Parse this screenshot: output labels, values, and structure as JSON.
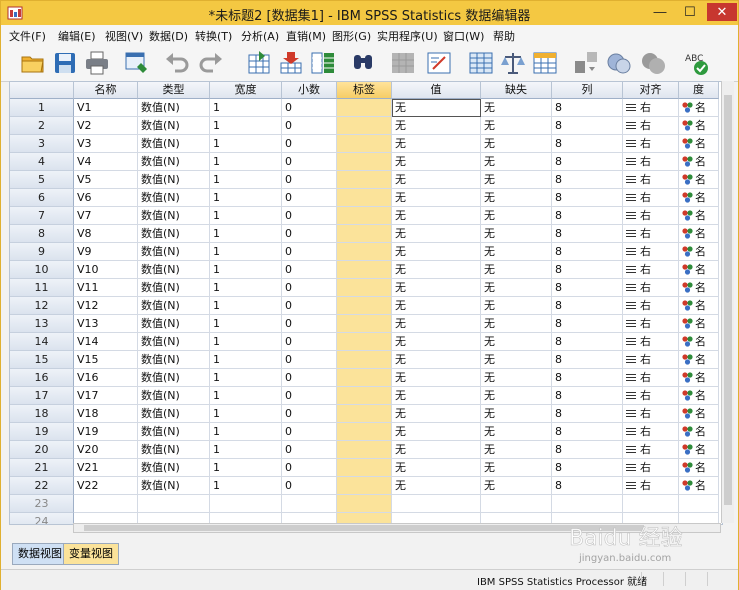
{
  "window": {
    "title": "*未标题2 [数据集1] - IBM SPSS Statistics 数据编辑器",
    "buttons": {
      "minimize": "—",
      "maximize": "☐",
      "close": "✕"
    }
  },
  "menu": [
    "文件(F)",
    "编辑(E)",
    "视图(V)",
    "数据(D)",
    "转换(T)",
    "分析(A)",
    "直销(M)",
    "图形(G)",
    "实用程序(U)",
    "窗口(W)",
    "帮助"
  ],
  "toolbar": [
    "open-icon",
    "save-icon",
    "print-icon",
    "dialog-recall-icon",
    "undo-icon",
    "redo-icon",
    "goto-case-icon",
    "goto-variable-icon",
    "variables-icon",
    "find-icon",
    "insert-cases-icon",
    "insert-variable-icon",
    "split-file-icon",
    "weight-cases-icon",
    "select-cases-icon",
    "value-labels-icon",
    "use-sets-icon",
    "show-all-icon",
    "spell-check-icon"
  ],
  "columns": [
    "名称",
    "类型",
    "宽度",
    "小数",
    "标签",
    "值",
    "缺失",
    "列",
    "对齐",
    "度"
  ],
  "rows": [
    {
      "num": "1",
      "name": "V1",
      "type": "数值(N)",
      "width": "1",
      "decimals": "0",
      "label": "",
      "values": "无",
      "missing": "无",
      "columns": "8",
      "align": "右",
      "measure": "名"
    },
    {
      "num": "2",
      "name": "V2",
      "type": "数值(N)",
      "width": "1",
      "decimals": "0",
      "label": "",
      "values": "无",
      "missing": "无",
      "columns": "8",
      "align": "右",
      "measure": "名"
    },
    {
      "num": "3",
      "name": "V3",
      "type": "数值(N)",
      "width": "1",
      "decimals": "0",
      "label": "",
      "values": "无",
      "missing": "无",
      "columns": "8",
      "align": "右",
      "measure": "名"
    },
    {
      "num": "4",
      "name": "V4",
      "type": "数值(N)",
      "width": "1",
      "decimals": "0",
      "label": "",
      "values": "无",
      "missing": "无",
      "columns": "8",
      "align": "右",
      "measure": "名"
    },
    {
      "num": "5",
      "name": "V5",
      "type": "数值(N)",
      "width": "1",
      "decimals": "0",
      "label": "",
      "values": "无",
      "missing": "无",
      "columns": "8",
      "align": "右",
      "measure": "名"
    },
    {
      "num": "6",
      "name": "V6",
      "type": "数值(N)",
      "width": "1",
      "decimals": "0",
      "label": "",
      "values": "无",
      "missing": "无",
      "columns": "8",
      "align": "右",
      "measure": "名"
    },
    {
      "num": "7",
      "name": "V7",
      "type": "数值(N)",
      "width": "1",
      "decimals": "0",
      "label": "",
      "values": "无",
      "missing": "无",
      "columns": "8",
      "align": "右",
      "measure": "名"
    },
    {
      "num": "8",
      "name": "V8",
      "type": "数值(N)",
      "width": "1",
      "decimals": "0",
      "label": "",
      "values": "无",
      "missing": "无",
      "columns": "8",
      "align": "右",
      "measure": "名"
    },
    {
      "num": "9",
      "name": "V9",
      "type": "数值(N)",
      "width": "1",
      "decimals": "0",
      "label": "",
      "values": "无",
      "missing": "无",
      "columns": "8",
      "align": "右",
      "measure": "名"
    },
    {
      "num": "10",
      "name": "V10",
      "type": "数值(N)",
      "width": "1",
      "decimals": "0",
      "label": "",
      "values": "无",
      "missing": "无",
      "columns": "8",
      "align": "右",
      "measure": "名"
    },
    {
      "num": "11",
      "name": "V11",
      "type": "数值(N)",
      "width": "1",
      "decimals": "0",
      "label": "",
      "values": "无",
      "missing": "无",
      "columns": "8",
      "align": "右",
      "measure": "名"
    },
    {
      "num": "12",
      "name": "V12",
      "type": "数值(N)",
      "width": "1",
      "decimals": "0",
      "label": "",
      "values": "无",
      "missing": "无",
      "columns": "8",
      "align": "右",
      "measure": "名"
    },
    {
      "num": "13",
      "name": "V13",
      "type": "数值(N)",
      "width": "1",
      "decimals": "0",
      "label": "",
      "values": "无",
      "missing": "无",
      "columns": "8",
      "align": "右",
      "measure": "名"
    },
    {
      "num": "14",
      "name": "V14",
      "type": "数值(N)",
      "width": "1",
      "decimals": "0",
      "label": "",
      "values": "无",
      "missing": "无",
      "columns": "8",
      "align": "右",
      "measure": "名"
    },
    {
      "num": "15",
      "name": "V15",
      "type": "数值(N)",
      "width": "1",
      "decimals": "0",
      "label": "",
      "values": "无",
      "missing": "无",
      "columns": "8",
      "align": "右",
      "measure": "名"
    },
    {
      "num": "16",
      "name": "V16",
      "type": "数值(N)",
      "width": "1",
      "decimals": "0",
      "label": "",
      "values": "无",
      "missing": "无",
      "columns": "8",
      "align": "右",
      "measure": "名"
    },
    {
      "num": "17",
      "name": "V17",
      "type": "数值(N)",
      "width": "1",
      "decimals": "0",
      "label": "",
      "values": "无",
      "missing": "无",
      "columns": "8",
      "align": "右",
      "measure": "名"
    },
    {
      "num": "18",
      "name": "V18",
      "type": "数值(N)",
      "width": "1",
      "decimals": "0",
      "label": "",
      "values": "无",
      "missing": "无",
      "columns": "8",
      "align": "右",
      "measure": "名"
    },
    {
      "num": "19",
      "name": "V19",
      "type": "数值(N)",
      "width": "1",
      "decimals": "0",
      "label": "",
      "values": "无",
      "missing": "无",
      "columns": "8",
      "align": "右",
      "measure": "名"
    },
    {
      "num": "20",
      "name": "V20",
      "type": "数值(N)",
      "width": "1",
      "decimals": "0",
      "label": "",
      "values": "无",
      "missing": "无",
      "columns": "8",
      "align": "右",
      "measure": "名"
    },
    {
      "num": "21",
      "name": "V21",
      "type": "数值(N)",
      "width": "1",
      "decimals": "0",
      "label": "",
      "values": "无",
      "missing": "无",
      "columns": "8",
      "align": "右",
      "measure": "名"
    },
    {
      "num": "22",
      "name": "V22",
      "type": "数值(N)",
      "width": "1",
      "decimals": "0",
      "label": "",
      "values": "无",
      "missing": "无",
      "columns": "8",
      "align": "右",
      "measure": "名"
    }
  ],
  "empty_rows": [
    "23",
    "24"
  ],
  "tabs": {
    "data_view": "数据视图",
    "variable_view": "变量视图"
  },
  "status": {
    "processor": "IBM SPSS Statistics Processor 就绪"
  },
  "watermark": {
    "brand": "Baidu 经验",
    "url": "jingyan.baidu.com"
  },
  "colors": {
    "title_bar": "#f4c842",
    "selected_column": "#fbe39a",
    "close_button": "#c7372f"
  }
}
